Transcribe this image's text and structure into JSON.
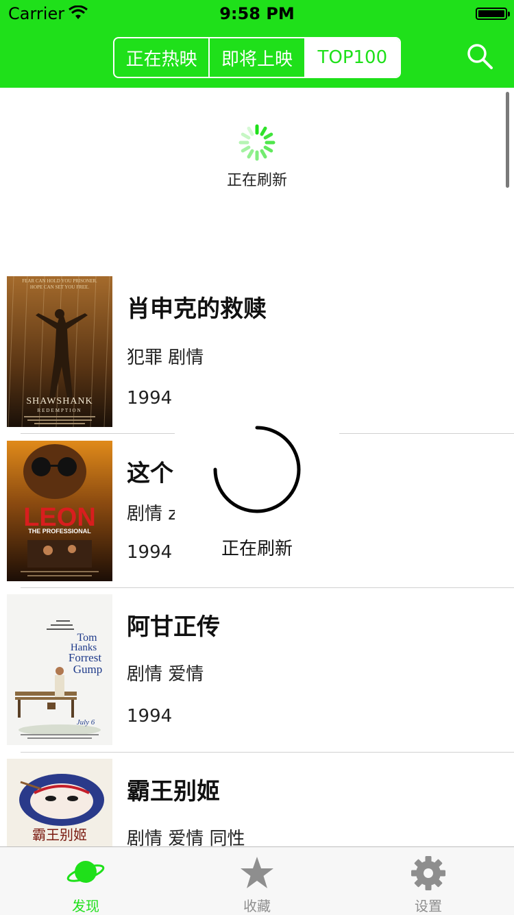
{
  "status_bar": {
    "carrier": "Carrier",
    "time": "9:58 PM"
  },
  "nav": {
    "segments": [
      "正在热映",
      "即将上映",
      "TOP100"
    ],
    "selected_segment": "TOP100",
    "search_icon": "search-icon"
  },
  "refresh": {
    "top_text": "正在刷新",
    "hud_text": "正在刷新"
  },
  "movies": [
    {
      "title": "肖申克的救赎",
      "genres": "犯罪 剧情",
      "year": "1994"
    },
    {
      "title": "这个",
      "genres": "剧情 z",
      "year": "1994"
    },
    {
      "title": "阿甘正传",
      "genres": "剧情 爱情",
      "year": "1994"
    },
    {
      "title": "霸王别姬",
      "genres": "剧情 爱情 同性",
      "year": ""
    }
  ],
  "posters": {
    "shawshank": {
      "tagline": "FEAR CAN HOLD YOU PRISONER.",
      "tagline2": "HOPE CAN SET YOU FREE.",
      "title": "SHAWSHANK",
      "subtitle": "REDEMPTION"
    },
    "leon": {
      "title": "LEON",
      "subtitle": "THE PROFESSIONAL"
    },
    "forrest": {
      "line1": "Tom",
      "line2": "Hanks",
      "line3": "Forrest",
      "line4": "Gump",
      "date": "July 6"
    },
    "farewell": {
      "title": "霸王别姬"
    }
  },
  "tabbar": {
    "items": [
      {
        "label": "发现",
        "icon": "planet-icon",
        "active": true
      },
      {
        "label": "收藏",
        "icon": "star-icon",
        "active": false
      },
      {
        "label": "设置",
        "icon": "gear-icon",
        "active": false
      }
    ]
  },
  "colors": {
    "accent": "#1fe01a",
    "inactive_tab": "#8e8e8e"
  }
}
